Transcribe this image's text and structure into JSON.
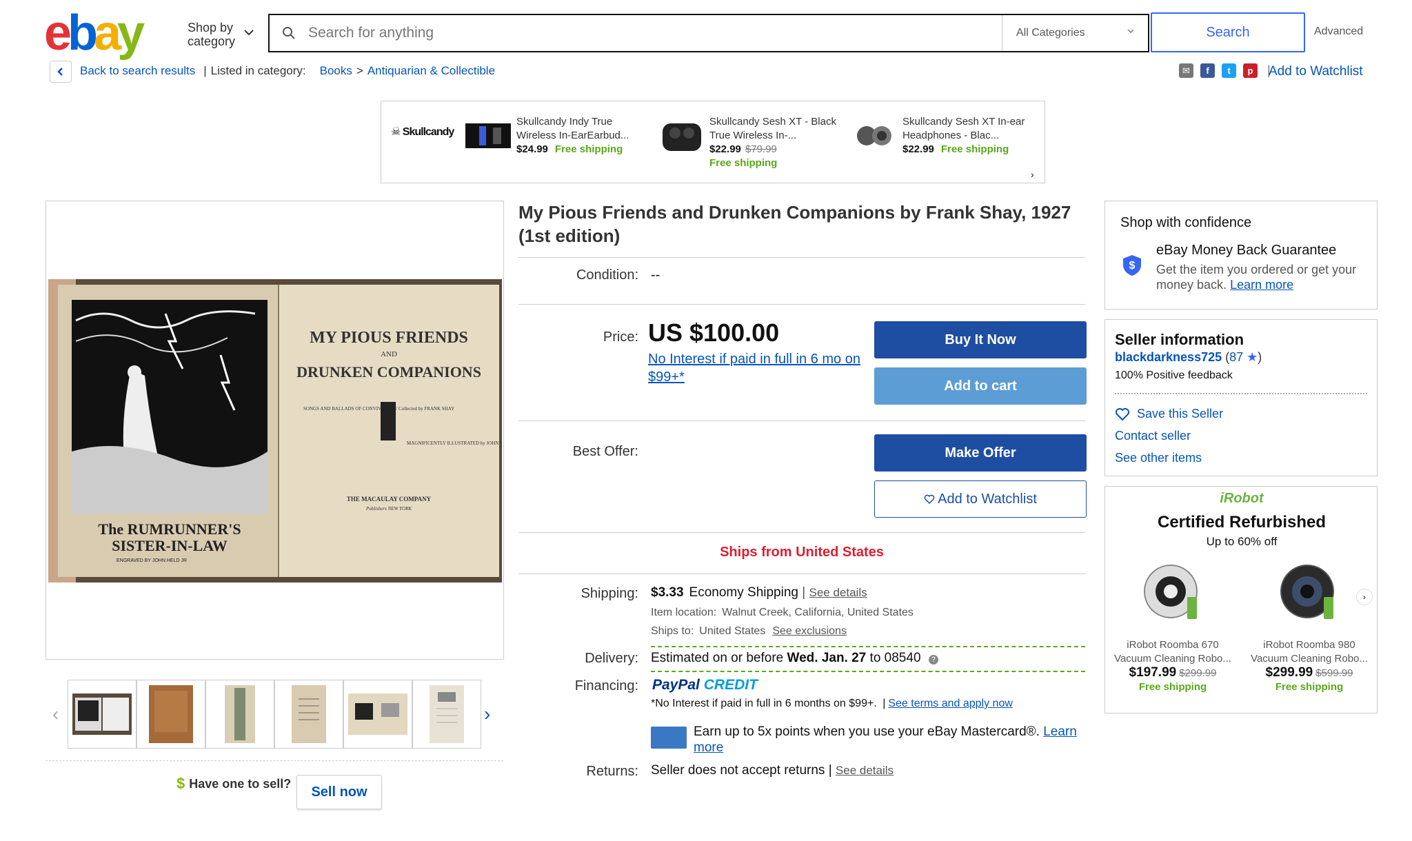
{
  "header": {
    "logo_letters": [
      "e",
      "b",
      "a",
      "y"
    ],
    "shop_by_category": "Shop by category",
    "search_placeholder": "Search for anything",
    "category_select": "All Categories",
    "search_button": "Search",
    "advanced": "Advanced"
  },
  "breadcrumb": {
    "back": "Back to search results",
    "separator": "|",
    "listed_in": "Listed in category:",
    "cat1": "Books",
    "arrow": ">",
    "cat2": "Antiquarian & Collectible",
    "add_watchlist": "Add to Watchlist"
  },
  "share_icons": [
    "email-icon",
    "facebook-icon",
    "twitter-icon",
    "pinterest-icon"
  ],
  "ad": {
    "brand": "Skullcandy",
    "items": [
      {
        "name": "Skullcandy Indy True Wireless In-EarEarbud...",
        "price": "$24.99",
        "was": "",
        "shipping": "Free shipping"
      },
      {
        "name": "Skullcandy Sesh XT - Black True Wireless In-...",
        "price": "$22.99",
        "was": "$79.99",
        "shipping": "Free shipping"
      },
      {
        "name": "Skullcandy Sesh XT In-ear Headphones - Blac...",
        "price": "$22.99",
        "was": "",
        "shipping": "Free shipping"
      }
    ],
    "next": "›"
  },
  "listing": {
    "title": "My Pious Friends and Drunken Companions by Frank Shay, 1927 (1st edition)",
    "condition_label": "Condition:",
    "condition_value": "--",
    "price_label": "Price:",
    "price": "US $100.00",
    "no_interest": "No Interest if paid in full in 6 mo on $99+*",
    "buy_now": "Buy It Now",
    "add_to_cart": "Add to cart",
    "best_offer_label": "Best Offer:",
    "make_offer": "Make Offer",
    "add_to_watchlist": "Add to Watchlist",
    "ships_from": "Ships from United States",
    "shipping_label": "Shipping:",
    "shipping_cost": "$3.33",
    "shipping_method": "Economy Shipping",
    "see_details": "See details",
    "item_location_label": "Item location:",
    "item_location": "Walnut Creek, California, United States",
    "ships_to_label": "Ships to:",
    "ships_to": "United States",
    "see_exclusions": "See exclusions",
    "delivery_label": "Delivery:",
    "delivery_prefix": "Estimated on or before",
    "delivery_date": "Wed. Jan. 27",
    "delivery_suffix": "to 08540",
    "financing_label": "Financing:",
    "paypal": "PayPal",
    "credit": "CREDIT",
    "financing_note": "*No Interest if paid in full in 6 months on $99+.",
    "see_terms": "See terms and apply now",
    "mastercard_text": "Earn up to 5x points when you use your eBay Mastercard®.",
    "learn_more": "Learn more",
    "returns_label": "Returns:",
    "returns_value": "Seller does not accept returns",
    "returns_details": "See details"
  },
  "image_text": {
    "left_caption_1": "The RUMRUNNER'S",
    "left_caption_2": "SISTER-IN-LAW",
    "left_caption_3": "ENGRAVED BY JOHN HELD JR",
    "right_title_1": "MY PIOUS FRIENDS",
    "right_title_2": "AND",
    "right_title_3": "DRUNKEN COMPANIONS",
    "right_left_block": "SONGS AND BALLADS OF CONVIVIALITY Collected by FRANK SHAY",
    "right_right_block": "MAGNIFICENTLY ILLUSTRATED by JOHN HELD JR.",
    "publisher": "THE MACAULAY COMPANY",
    "publisher_city": "Publishers NEW YORK"
  },
  "thumbnails_count": 6,
  "sell": {
    "dollar": "$",
    "have_one": "Have one to sell?",
    "sell_now": "Sell now"
  },
  "confidence": {
    "title": "Shop with confidence",
    "mbg_title": "eBay Money Back Guarantee",
    "mbg_text": "Get the item you ordered or get your money back.",
    "learn_more": "Learn more"
  },
  "seller": {
    "title": "Seller information",
    "name": "blackdarkness725",
    "score": "87",
    "feedback": "100% Positive feedback",
    "save": "Save this Seller",
    "contact": "Contact seller",
    "other": "See other items"
  },
  "irobot": {
    "brand": "iRobot",
    "headline": "Certified Refurbished",
    "sub": "Up to 60% off",
    "items": [
      {
        "name": "iRobot Roomba 670",
        "desc": "Vacuum Cleaning Robo...",
        "price": "$197.99",
        "was": "$299.99",
        "shipping": "Free shipping"
      },
      {
        "name": "iRobot Roomba 980",
        "desc": "Vacuum Cleaning Robo...",
        "price": "$299.99",
        "was": "$599.99",
        "shipping": "Free shipping"
      }
    ]
  },
  "colors": {
    "link": "#0654ba",
    "buy_button": "#1e4ea1",
    "cart_button": "#5d9dd6",
    "ships_from": "#dd1e31",
    "free_shipping": "#5ba71b"
  }
}
